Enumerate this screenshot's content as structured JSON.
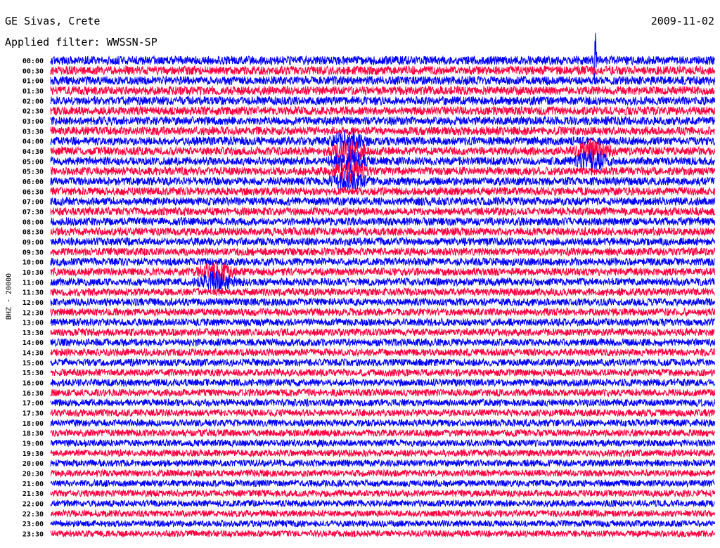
{
  "header": {
    "station": "GE Sivas, Crete",
    "filter": "Applied filter: WWSSN-SP",
    "date": "2009-11-02"
  },
  "chart_data": {
    "type": "line",
    "channel_label": "BHZ - 20000",
    "row_labels": [
      "00:00",
      "00:30",
      "01:00",
      "01:30",
      "02:00",
      "02:30",
      "03:00",
      "03:30",
      "04:00",
      "04:30",
      "05:00",
      "05:30",
      "06:00",
      "06:30",
      "07:00",
      "07:30",
      "08:00",
      "08:30",
      "09:00",
      "09:30",
      "10:00",
      "10:30",
      "11:00",
      "11:30",
      "12:00",
      "12:30",
      "13:00",
      "13:30",
      "14:00",
      "14:30",
      "15:00",
      "15:30",
      "16:00",
      "16:30",
      "17:00",
      "17:30",
      "18:00",
      "18:30",
      "19:00",
      "19:30",
      "20:00",
      "20:30",
      "21:00",
      "21:30",
      "22:00",
      "22:30",
      "23:00",
      "23:30"
    ],
    "trace_colors": [
      "#0000ff",
      "#ff0040"
    ],
    "x_range_minutes": [
      0,
      30
    ],
    "events": [
      {
        "row_label": "04:00",
        "minute": 13.5,
        "description": "burst"
      },
      {
        "row_label": "04:30",
        "minute": 13.5,
        "description": "burst"
      },
      {
        "row_label": "05:00",
        "minute": 13.5,
        "description": "burst"
      },
      {
        "row_label": "05:30",
        "minute": 13.5,
        "description": "burst"
      },
      {
        "row_label": "06:00",
        "minute": 13.5,
        "description": "burst"
      },
      {
        "row_label": "00:00",
        "minute": 24.6,
        "description": "spike"
      },
      {
        "row_label": "04:30",
        "minute": 24.5,
        "description": "burst"
      },
      {
        "row_label": "05:00",
        "minute": 24.5,
        "description": "burst"
      },
      {
        "row_label": "10:30",
        "minute": 7.5,
        "description": "burst"
      },
      {
        "row_label": "11:00",
        "minute": 7.5,
        "description": "burst"
      }
    ]
  }
}
